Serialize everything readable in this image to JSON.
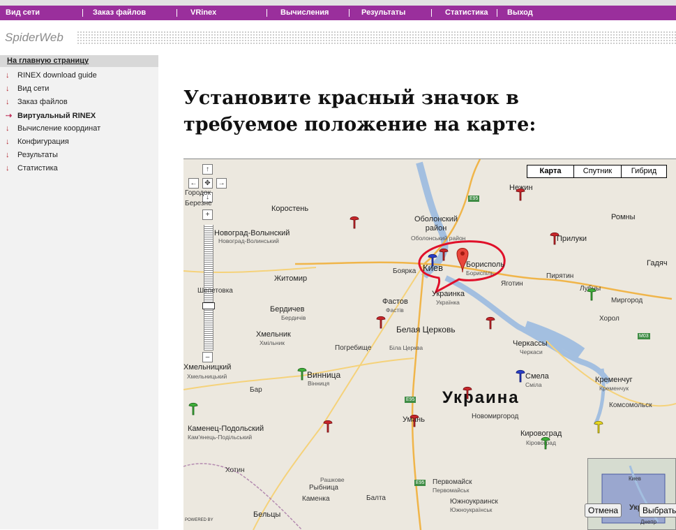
{
  "nav": [
    "Вид сети",
    "Заказ файлов",
    "VRinex",
    "Вычисления",
    "Результаты",
    "Статистика",
    "Выход"
  ],
  "brand": "SpiderWeb",
  "sidebar": {
    "home": "На главную страницу",
    "items": [
      "RINEX download guide",
      "Вид сети",
      "Заказ файлов",
      "Виртуальный RINEX",
      "Вычисление координат",
      "Конфигурация",
      "Результаты",
      "Статистика"
    ],
    "active_index": 3
  },
  "heading": "Установите красный значок в требуемое положение на карте:",
  "map": {
    "type_buttons": [
      "Карта",
      "Спутник",
      "Гибрид"
    ],
    "selected_type": "Карта",
    "controls": {
      "up": "↑",
      "left": "←",
      "center": "✥",
      "right": "→",
      "down": "↓",
      "zoom_in": "+",
      "zoom_out": "–"
    },
    "country": "Украина",
    "cities": {
      "korosten": "Коростень",
      "novograd": "Новоград-Волынский",
      "novograd_ua": "Новоград-Волинський",
      "obolon": "Оболонский район",
      "obolon_ua": "Оболонський район",
      "nezhin": "Нежин",
      "romny": "Ромны",
      "priluki": "Прилуки",
      "gadyach": "Гадяч",
      "kiev": "Киев",
      "boryspil": "Борисполь",
      "boryspil_ua": "Бориспіль",
      "boyarka": "Боярка",
      "zhitomir": "Житомир",
      "yagotin": "Яготин",
      "piryatin": "Пирятин",
      "lubny": "Лубны",
      "mirgorod": "Миргород",
      "fastov": "Фастов",
      "fastov_ua": "Фастів",
      "ukrainka": "Украинка",
      "ukrainka_ua": "Українка",
      "berdichev": "Бердичев",
      "berdichev_ua": "Бердичів",
      "belaya_tserkov": "Белая Церковь",
      "belaya_tserkov_ua": "Біла Церква",
      "khorol": "Хорол",
      "khmelnik": "Хмельник",
      "khmelnik_ua": "Хмільник",
      "pogrebishche": "Погребище",
      "cherkassy": "Черкассы",
      "cherkassy_ua": "Черкаси",
      "khmelnitsky": "Хмельницкий",
      "khmelnitsky_ua": "Хмельницький",
      "vinnitsa": "Винница",
      "vinnitsa_ua": "Вінниця",
      "smela": "Смела",
      "smela_ua": "Сміла",
      "kremenchug": "Кременчуг",
      "kremenchug_ua": "Кременчук",
      "bar": "Бар",
      "komsomolsk": "Комсомольск",
      "kamenets": "Каменец-Подольский",
      "kamenets_ua": "Кам'янець-Подільський",
      "uman": "Умань",
      "novomirgorod": "Новомиргород",
      "kirovograd": "Кировоград",
      "kirovograd_ua": "Кіровоград",
      "pervomaisk": "Первомайск",
      "pervomaisk_ua": "Первомайськ",
      "yuzhnoukrainsk": "Южноукраинск",
      "yuzhnoukrainsk_ua": "Южноукраїнськ",
      "kamenka": "Каменка",
      "rybnitsa": "Рыбница",
      "rybnitsa_ua": "Рашкове",
      "baltа": "Балта",
      "belzy": "Бельцы",
      "hotin": "Хотин",
      "dnipro": "Днепр",
      "gorodok": "Городок",
      "berezne": "Березне",
      "shepetovka": "Шепетовка"
    },
    "roads": [
      "E95",
      "E95",
      "E95",
      "M03"
    ],
    "powered_by": "POWERED BY",
    "minimap": {
      "city": "Киев",
      "ukraine": "Укр",
      "dnepr": "Днепр"
    },
    "buttons": {
      "cancel": "Отмена",
      "select": "Выбрать"
    },
    "colors": {
      "red": "#c7262a",
      "blue": "#2a3fc7",
      "green": "#3fb03a",
      "yellow": "#e8d820",
      "marker": "#e8473c",
      "circle": "#e0102a"
    }
  }
}
